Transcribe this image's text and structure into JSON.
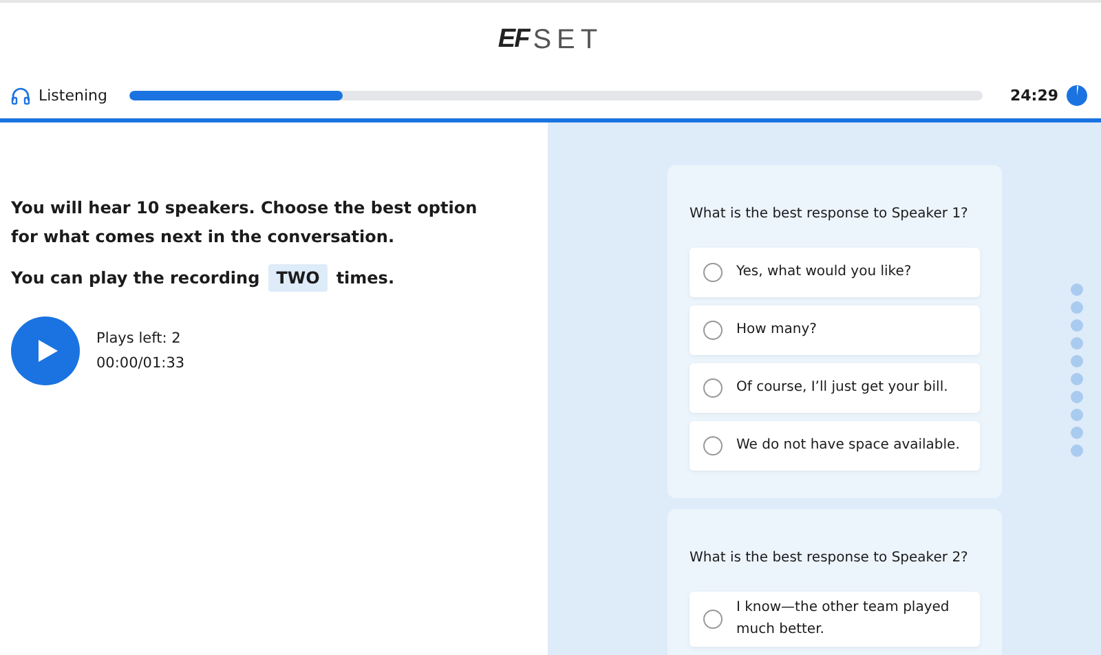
{
  "header": {
    "logo_mark": "EF",
    "logo_word": "SET"
  },
  "progress": {
    "section": "Listening",
    "level": 0.25,
    "time_left": "24:29"
  },
  "instructions": {
    "intro": "You will hear 10 speakers. Choose the best option for what comes next in the conversation.",
    "plays_before": "You can play the recording",
    "plays_count": "TWO",
    "plays_after": "times."
  },
  "player": {
    "plays_left": "Plays left: 2",
    "time": "00:00/01:33"
  },
  "questions": [
    {
      "prompt": "What is the best response to Speaker 1?",
      "options": [
        {
          "label": "Yes, what would you like?",
          "selected": false
        },
        {
          "label": "How many?",
          "selected": false
        },
        {
          "label": "Of course, I’ll just get your bill.",
          "selected": false
        },
        {
          "label": "We do not have space available.",
          "selected": false
        }
      ]
    },
    {
      "prompt": "What is the best response to Speaker 2?",
      "options": [
        {
          "label": "I know—the other team played much better.",
          "selected": false
        }
      ]
    }
  ],
  "question_nav": [
    {
      "answered": false
    },
    {
      "answered": false
    },
    {
      "answered": false
    },
    {
      "answered": false
    },
    {
      "answered": false
    },
    {
      "answered": false
    },
    {
      "answered": false
    },
    {
      "answered": false
    },
    {
      "answered": false
    },
    {
      "answered": false
    }
  ]
}
